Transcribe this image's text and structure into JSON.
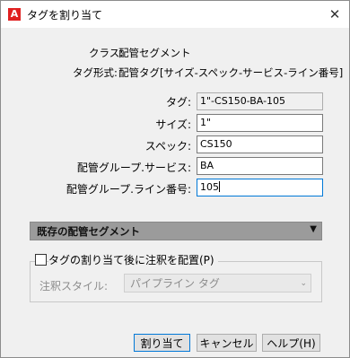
{
  "window": {
    "title": "タグを割り当て",
    "app_icon": "A",
    "close_glyph": "✕"
  },
  "info": {
    "class_label": "クラス:",
    "class_value": "配管セグメント",
    "format_label": "タグ形式:",
    "format_value": "配管タグ[サイズ-スペック-サービス-ライン番号]"
  },
  "fields": {
    "tag": {
      "label": "タグ:",
      "value": "1\"-CS150-BA-105"
    },
    "size": {
      "label": "サイズ:",
      "value": "1\""
    },
    "spec": {
      "label": "スペック:",
      "value": "CS150"
    },
    "service": {
      "label": "配管グループ.サービス:",
      "value": "BA"
    },
    "line_number": {
      "label": "配管グループ.ライン番号:",
      "value": "105"
    }
  },
  "segment": {
    "title": "既存の配管セグメント",
    "arrow": "▼"
  },
  "annotate": {
    "checkbox_label": "タグの割り当て後に注釈を配置(P)",
    "checked": false,
    "style_label": "注釈スタイル:",
    "style_value": "パイプライン タグ",
    "dropdown_glyph": "⌄"
  },
  "buttons": {
    "assign": "割り当て",
    "cancel": "キャンセル",
    "help": "ヘルプ(H)"
  }
}
